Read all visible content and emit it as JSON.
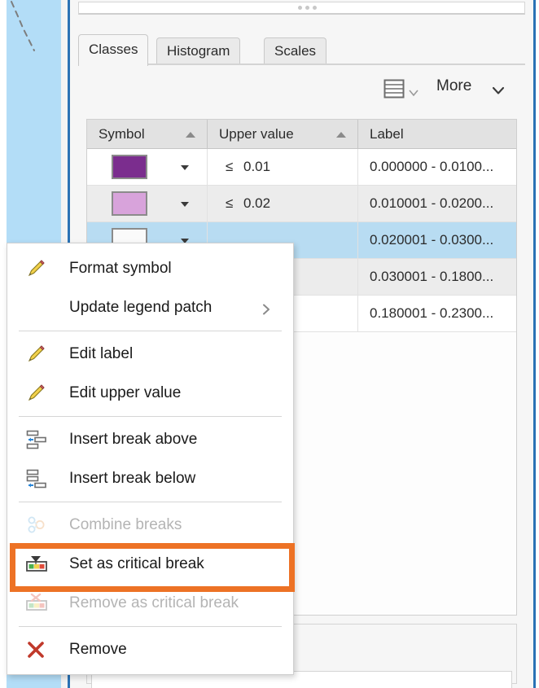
{
  "panel": {
    "tabs": [
      {
        "label": "Classes",
        "active": true
      },
      {
        "label": "Histogram",
        "active": false
      },
      {
        "label": "Scales",
        "active": false
      }
    ],
    "toolbar": {
      "list_view_icon": "list-view-icon",
      "list_view_caret_icon": "chevron-down-icon",
      "more_label": "More",
      "more_caret_icon": "chevron-down-icon"
    }
  },
  "table": {
    "columns": [
      {
        "label": "Symbol",
        "sort": "asc"
      },
      {
        "label": "Upper value",
        "sort": "asc"
      },
      {
        "label": "Label",
        "sort": "none"
      }
    ],
    "rows": [
      {
        "swatch_color": "#7B2D8E",
        "operator": "≤",
        "upper_value": "0.01",
        "label": "0.000000 - 0.0100...",
        "selected": false
      },
      {
        "swatch_color": "#D8A3DB",
        "operator": "≤",
        "upper_value": "0.02",
        "label": "0.010001 - 0.0200...",
        "selected": false
      },
      {
        "swatch_color": "#FAFAFA",
        "operator": "",
        "upper_value": "",
        "label": "0.020001 - 0.0300...",
        "selected": true
      },
      {
        "swatch_color": "#FFFFFF",
        "operator": "",
        "upper_value": "",
        "label": "0.030001 - 0.1800...",
        "selected": false
      },
      {
        "swatch_color": "#FFFFFF",
        "operator": "",
        "upper_value": "",
        "label": "0.180001 - 0.2300...",
        "selected": false
      }
    ]
  },
  "context_menu": {
    "items": [
      {
        "label": "Format symbol",
        "icon": "pencil-icon",
        "disabled": false,
        "submenu": false
      },
      {
        "label": "Update legend patch",
        "icon": "none",
        "disabled": false,
        "submenu": true
      },
      {
        "label": "Edit label",
        "icon": "pencil-icon",
        "disabled": false,
        "submenu": false
      },
      {
        "label": "Edit upper value",
        "icon": "pencil-icon",
        "disabled": false,
        "submenu": false
      },
      {
        "label": "Insert break above",
        "icon": "insert-break-above-icon",
        "disabled": false,
        "submenu": false
      },
      {
        "label": "Insert break below",
        "icon": "insert-break-below-icon",
        "disabled": false,
        "submenu": false
      },
      {
        "label": "Combine breaks",
        "icon": "combine-breaks-icon",
        "disabled": true,
        "submenu": false
      },
      {
        "label": "Set as critical break",
        "icon": "set-critical-break-icon",
        "disabled": false,
        "submenu": false
      },
      {
        "label": "Remove as critical break",
        "icon": "remove-critical-break-icon",
        "disabled": true,
        "submenu": false
      },
      {
        "label": "Remove",
        "icon": "red-x-icon",
        "disabled": false,
        "submenu": false
      }
    ]
  },
  "annotation": {
    "highlight_color": "#ED7225",
    "highlights_item": "Set as critical break"
  },
  "colors": {
    "panel_border_blue": "#2A72B5",
    "selection_blue": "#B8DCF2",
    "map_water": "#B3DDF7"
  }
}
